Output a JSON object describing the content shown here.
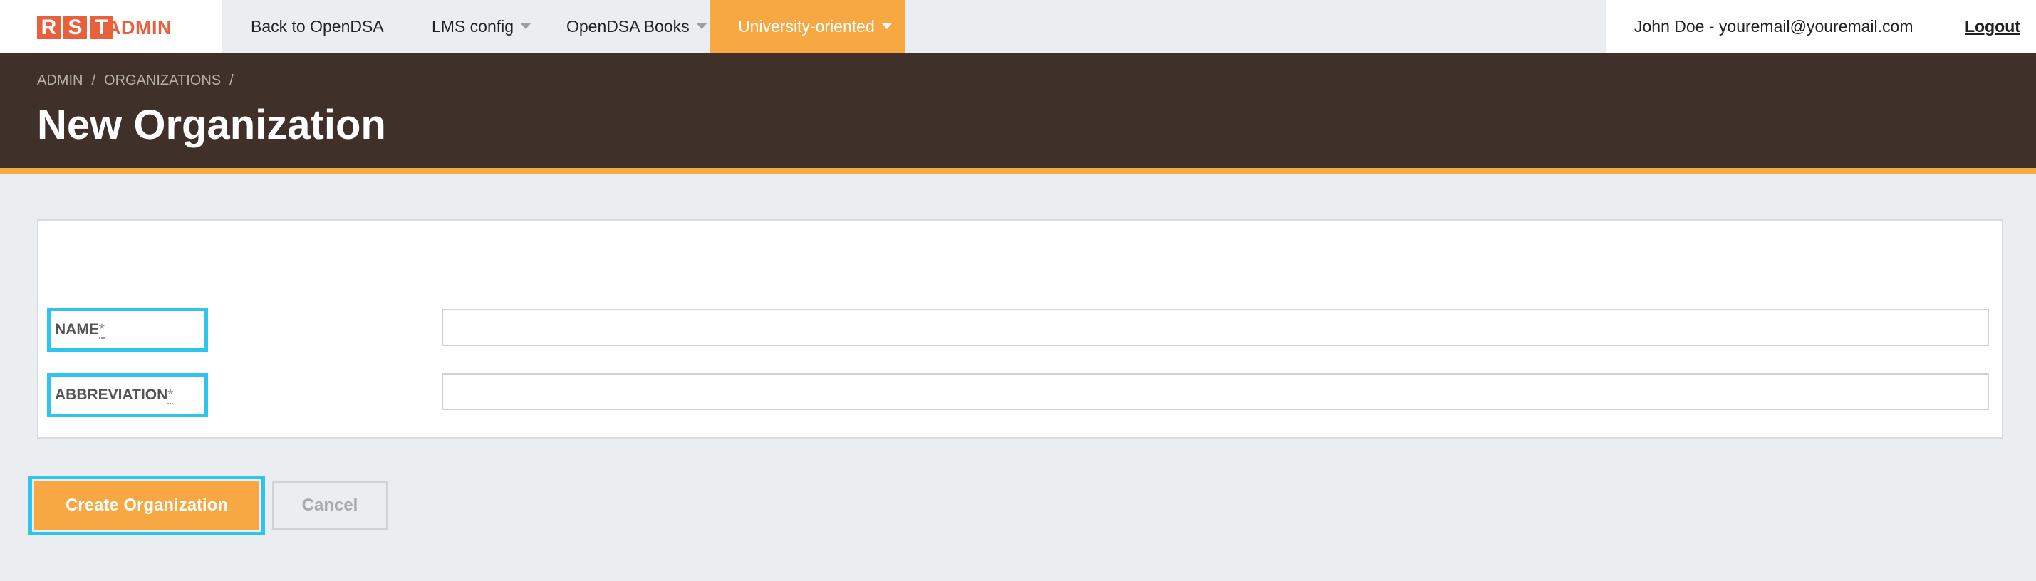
{
  "logo": {
    "letters": [
      "R",
      "S",
      "T"
    ],
    "admin": "ADMIN"
  },
  "nav": {
    "items": [
      {
        "label": "Back to OpenDSA"
      },
      {
        "label": "LMS config"
      },
      {
        "label": "OpenDSA Books"
      },
      {
        "label": "University-oriented"
      }
    ],
    "user": "John Doe - youremail@youremail.com",
    "logout": "Logout"
  },
  "breadcrumb": {
    "items": [
      "ADMIN",
      "/",
      "ORGANIZATIONS",
      "/"
    ]
  },
  "page_title": "New Organization",
  "form": {
    "name_label": "NAME",
    "name_required": "*",
    "name_value": "",
    "abbreviation_label": "ABBREVIATION",
    "abbreviation_required": "*",
    "abbreviation_value": ""
  },
  "buttons": {
    "create": "Create Organization",
    "cancel": "Cancel"
  },
  "colors": {
    "accent": "#f7a843",
    "brand": "#e8603c",
    "header_bg": "#40302a",
    "highlight": "#2ec4ee"
  }
}
